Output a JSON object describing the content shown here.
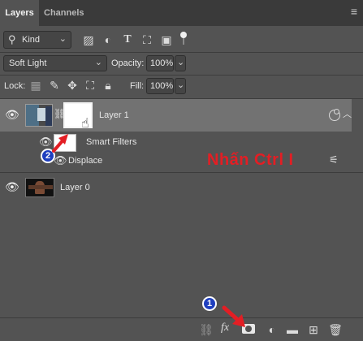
{
  "tabs": {
    "layers": "Layers",
    "channels": "Channels"
  },
  "panel_menu": "≡",
  "filter": {
    "kind_label": "Kind"
  },
  "blend": {
    "mode": "Soft Light",
    "opacity_label": "Opacity:",
    "opacity_value": "100%"
  },
  "lock": {
    "label": "Lock:",
    "fill_label": "Fill:",
    "fill_value": "100%"
  },
  "layers": [
    {
      "name": "Layer 1",
      "smart_filters": "Smart Filters",
      "filter_name": "Displace"
    },
    {
      "name": "Layer 0"
    }
  ],
  "annotation": {
    "text": "Nhấn Ctrl I",
    "marker_1": "1",
    "marker_2": "2",
    "color": "#e31e24"
  },
  "colors": {
    "panel": "#535353",
    "tabbar": "#3a3a3a",
    "selected_row": "#727272",
    "marker_blue": "#1f3fbf"
  }
}
